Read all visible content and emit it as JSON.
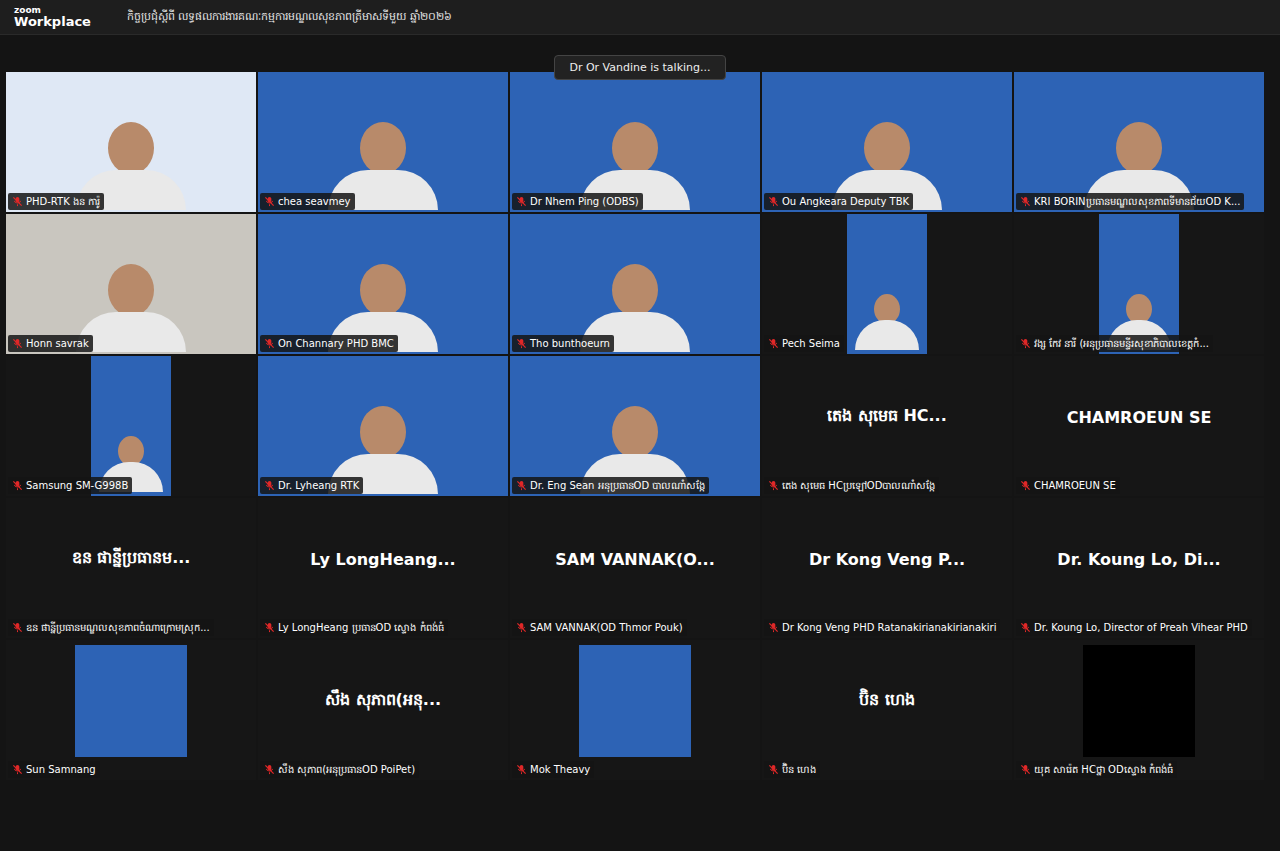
{
  "window": {
    "logo_top": "zoom",
    "logo_bottom": "Workplace",
    "title": "កិច្ចប្រជុំស្តីពី លទ្ធផលការងារគណៈកម្មការមណ្ឌលសុខភាពត្រីមាសទីមួយ ឆ្នាំ២០២៦"
  },
  "speaker": {
    "text": "Dr Or Vandine is talking..."
  },
  "tiles": [
    {
      "kind": "video",
      "color": "#dfe8f5",
      "display": "",
      "label": "PHD-RTK ងន ការ៉ូ",
      "muted": true
    },
    {
      "kind": "video",
      "color": "#2d63b5",
      "display": "",
      "label": "chea seavmey",
      "muted": true
    },
    {
      "kind": "video",
      "color": "#2d63b5",
      "display": "",
      "label": "Dr Nhem Ping (ODBS)",
      "muted": true
    },
    {
      "kind": "video",
      "color": "#2d63b5",
      "display": "",
      "label": "Ou Angkeara Deputy TBK",
      "muted": true
    },
    {
      "kind": "video",
      "color": "#2d63b5",
      "display": "",
      "label": "KRI BORINប្រធានមណ្ឌលសុខភាពទីមានជ័យOD K...",
      "muted": true
    },
    {
      "kind": "video",
      "color": "#c9c6bf",
      "display": "",
      "label": "Honn savrak",
      "muted": true
    },
    {
      "kind": "video",
      "color": "#2d63b5",
      "display": "",
      "label": "On Channary PHD BMC",
      "muted": true
    },
    {
      "kind": "video",
      "color": "#2d63b5",
      "display": "",
      "label": "Tho bunthoeurn",
      "muted": true
    },
    {
      "kind": "narrow",
      "color": "#2d63b5",
      "display": "",
      "label": "Pech Seima",
      "muted": true
    },
    {
      "kind": "narrow",
      "color": "#2d63b5",
      "display": "",
      "label": "វង្ស កែវ នារី (អនុប្រធានមន្ទីរសុខាភិបាលខេត្តកំ...",
      "muted": true
    },
    {
      "kind": "narrow",
      "color": "#2d63b5",
      "display": "",
      "label": "Samsung SM-G998B",
      "muted": true
    },
    {
      "kind": "video",
      "color": "#2d63b5",
      "display": "",
      "label": "Dr. Lyheang RTK",
      "muted": true
    },
    {
      "kind": "video",
      "color": "#2d63b5",
      "display": "",
      "label": "Dr. Eng Sean អនុប្រធានOD បាលណាំសង្កែ",
      "muted": true
    },
    {
      "kind": "name",
      "color": "#1c1c1c",
      "display": "តេង សុមេធ HC...",
      "label": "តេង សុមេធ HCប្រឡៅODបាលណាំសង្កែ",
      "muted": true
    },
    {
      "kind": "name",
      "color": "#1c1c1c",
      "display": "CHAMROEUN SE",
      "label": "CHAMROEUN SE",
      "muted": true
    },
    {
      "kind": "name",
      "color": "#1c1c1c",
      "display": "ឧន ផាន្នីប្រធានម...",
      "label": "ឧន ផាន្នីប្រធានមណ្ឌលសុខភាពចំណាក្រោមស្រុក...",
      "muted": true
    },
    {
      "kind": "name",
      "color": "#1c1c1c",
      "display": "Ly  LongHeang...",
      "label": "Ly LongHeang ប្រធានOD ស្ទោង កំពង់ធំ",
      "muted": true
    },
    {
      "kind": "name",
      "color": "#1c1c1c",
      "display": "SAM  VANNAK(O...",
      "label": "SAM VANNAK(OD Thmor Pouk)",
      "muted": true
    },
    {
      "kind": "name",
      "color": "#1c1c1c",
      "display": "Dr Kong Veng P...",
      "label": "Dr Kong Veng PHD Ratanakirianakirianakiri",
      "muted": true
    },
    {
      "kind": "name",
      "color": "#1c1c1c",
      "display": "Dr. Koung Lo, Di...",
      "label": "Dr. Koung Lo, Director of Preah Vihear PHD",
      "muted": true
    },
    {
      "kind": "image",
      "color": "#2d63b5",
      "display": "",
      "label": "Sun Samnang",
      "muted": true
    },
    {
      "kind": "name",
      "color": "#1c1c1c",
      "display": "សឹង សុភាព(អនុ...",
      "label": "សឹង សុភាព(អនុប្រធានOD PoiPet)",
      "muted": true
    },
    {
      "kind": "image",
      "color": "#2d63b5",
      "display": "",
      "label": "Mok Theavy",
      "muted": true
    },
    {
      "kind": "name",
      "color": "#1c1c1c",
      "display": "ប៊ិន ហេង",
      "label": "ប៊ិន ហេង",
      "muted": true
    },
    {
      "kind": "image",
      "color": "#000000",
      "display": "",
      "label": "យុគ សារ៉េត HCថ្នា ODស្ទោង កំពង់ធំ",
      "muted": true
    }
  ]
}
